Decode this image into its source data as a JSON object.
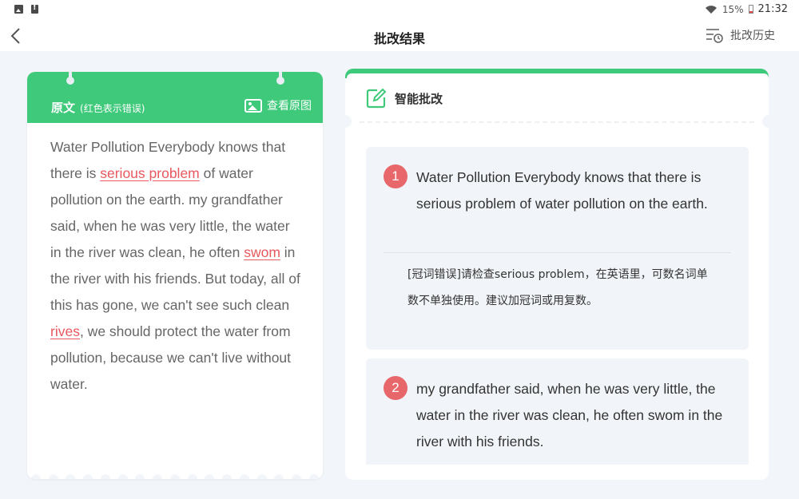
{
  "status_bar": {
    "battery": "15%",
    "time": "21:32"
  },
  "header": {
    "title": "批改结果",
    "history_label": "批改历史"
  },
  "original": {
    "title": "原文",
    "subtitle": "(红色表示错误)",
    "view_original_label": "查看原图",
    "segments": [
      {
        "text": "Water Pollution  Everybody knows that there is ",
        "error": false
      },
      {
        "text": "serious problem",
        "error": true
      },
      {
        "text": " of water pollution on the earth. my grandfather said, when he was very little, the water in the river was clean, he often ",
        "error": false
      },
      {
        "text": "swom",
        "error": true
      },
      {
        "text": " in the river with his friends.  But today, all of this has gone, we can't see such clean ",
        "error": false
      },
      {
        "text": "rives",
        "error": true
      },
      {
        "text": ", we should protect the water from pollution, because we can't live without water.",
        "error": false
      }
    ]
  },
  "smart_review": {
    "title": "智能批改",
    "items": [
      {
        "number": "1",
        "sentence": "Water Pollution  Everybody knows that there is serious problem of water pollution on the earth.",
        "comment": "[冠词错误]请检查serious problem，在英语里，可数名词单数不单独使用。建议加冠词或用复数。"
      },
      {
        "number": "2",
        "sentence": "my grandfather said, when he was very little, the water in the river was clean, he often swom in the river with his friends."
      }
    ]
  },
  "colors": {
    "accent_green": "#3fc97a",
    "error_red": "#e8585d",
    "number_badge": "#e8676b",
    "background": "#f2f5f9"
  }
}
